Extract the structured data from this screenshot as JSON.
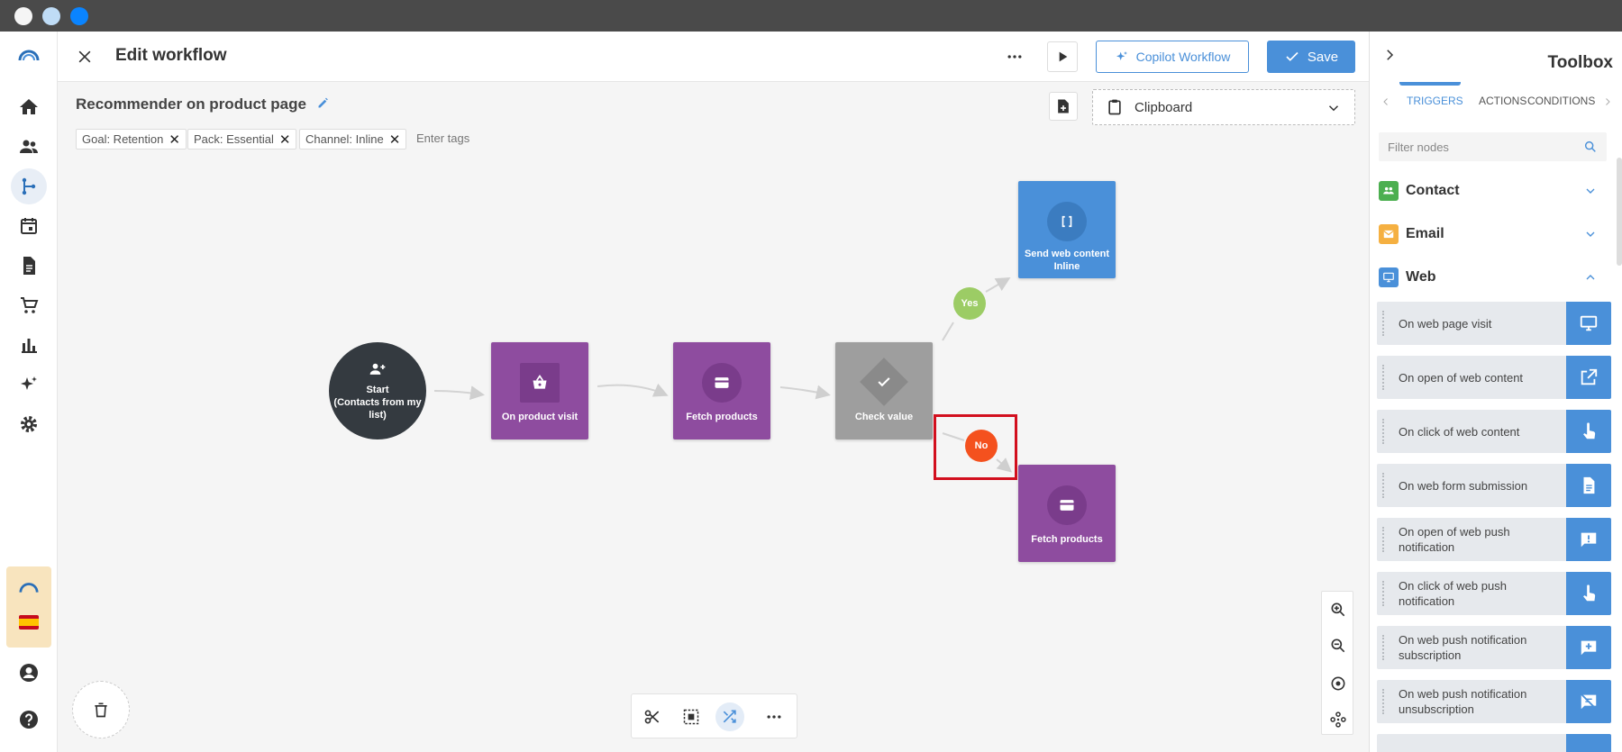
{
  "header": {
    "title": "Edit workflow",
    "copilot_label": "Copilot Workflow",
    "save_label": "Save"
  },
  "workflow": {
    "name": "Recommender on product page",
    "tags": [
      "Goal: Retention",
      "Pack: Essential",
      "Channel: Inline"
    ],
    "tag_placeholder": "Enter tags",
    "clipboard_label": "Clipboard"
  },
  "canvas": {
    "start_lines": [
      "Start",
      "(Contacts from my",
      "list)"
    ],
    "nodes": {
      "product_visit": "On product visit",
      "fetch1": "Fetch products",
      "check": "Check value",
      "send_web": [
        "Send web content",
        "Inline"
      ],
      "fetch2": "Fetch products"
    },
    "yes_label": "Yes",
    "no_label": "No"
  },
  "toolbox": {
    "title": "Toolbox",
    "tabs": [
      "TRIGGERS",
      "ACTIONS",
      "CONDITIONS"
    ],
    "active_tab": "TRIGGERS",
    "filter_placeholder": "Filter nodes",
    "categories": [
      "Contact",
      "Email",
      "Web"
    ],
    "web_items": [
      "On web page visit",
      "On open of web content",
      "On click of web content",
      "On web form submission",
      "On open of web push notification",
      "On click of web push notification",
      "On web push notification subscription",
      "On web push notification unsubscription"
    ]
  },
  "colors": {
    "accent": "#4a90d9",
    "node_purple": "#8e4c9f",
    "node_grey": "#9e9e9e",
    "start_dark": "#343a40",
    "yes_green": "#9ccc65",
    "no_red": "#f4511e",
    "highlight_red": "#d20f1e"
  }
}
